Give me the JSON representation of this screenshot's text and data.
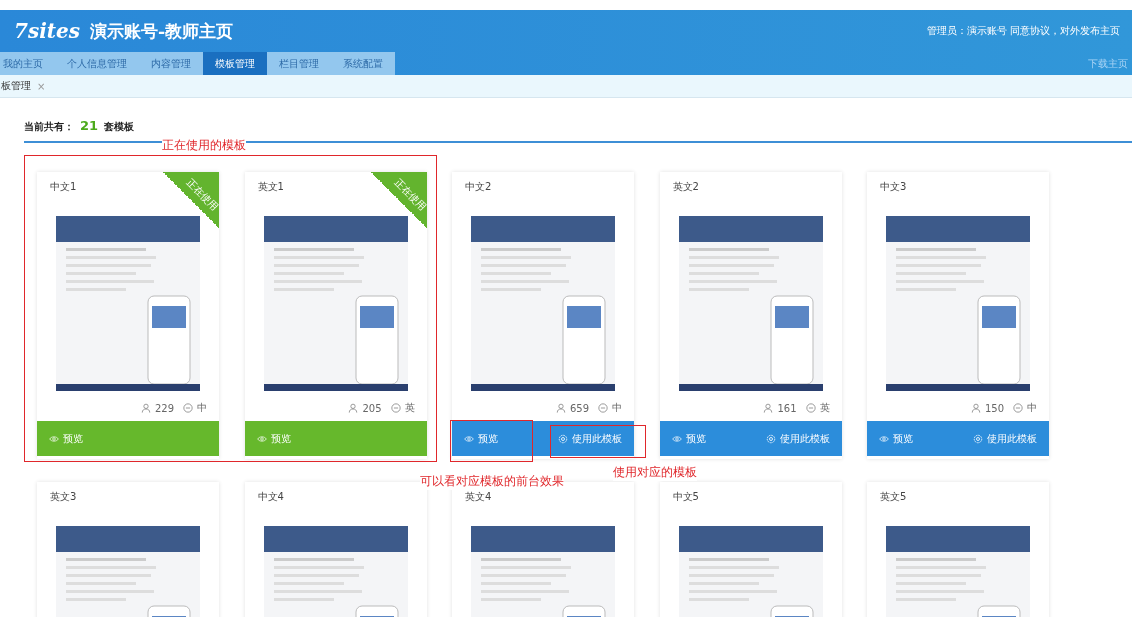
{
  "header": {
    "logo": "7sites",
    "title": "演示账号-教师主页",
    "admin_info": "管理员：演示账号 同意协议，对外发布主页",
    "download_link": "下载主页"
  },
  "nav_tabs": [
    {
      "label": "我的主页",
      "selected": false
    },
    {
      "label": "个人信息管理",
      "selected": false
    },
    {
      "label": "内容管理",
      "selected": false
    },
    {
      "label": "模板管理",
      "selected": true
    },
    {
      "label": "栏目管理",
      "selected": false
    },
    {
      "label": "系统配置",
      "selected": false
    }
  ],
  "open_tabs": [
    {
      "label": "板管理",
      "close": "×"
    }
  ],
  "summary": {
    "prefix": "当前共有：",
    "count": "21",
    "suffix": "套模板"
  },
  "templates": [
    {
      "name": "中文1",
      "in_use": true,
      "ribbon": "正在使用",
      "views": "229",
      "language": "中",
      "preview": "预览"
    },
    {
      "name": "英文1",
      "in_use": true,
      "ribbon": "正在使用",
      "views": "205",
      "language": "英",
      "preview": "预览"
    },
    {
      "name": "中文2",
      "in_use": false,
      "views": "659",
      "language": "中",
      "preview": "预览",
      "use": "使用此模板"
    },
    {
      "name": "英文2",
      "in_use": false,
      "views": "161",
      "language": "英",
      "preview": "预览",
      "use": "使用此模板"
    },
    {
      "name": "中文3",
      "in_use": false,
      "views": "150",
      "language": "中",
      "preview": "预览",
      "use": "使用此模板"
    },
    {
      "name": "英文3"
    },
    {
      "name": "中文4"
    },
    {
      "name": "英文4"
    },
    {
      "name": "中文5"
    },
    {
      "name": "英文5"
    }
  ],
  "annotations": [
    {
      "text": "正在使用的模板"
    },
    {
      "text": "可以看对应模板的前台效果"
    },
    {
      "text": "使用对应的模板"
    }
  ]
}
